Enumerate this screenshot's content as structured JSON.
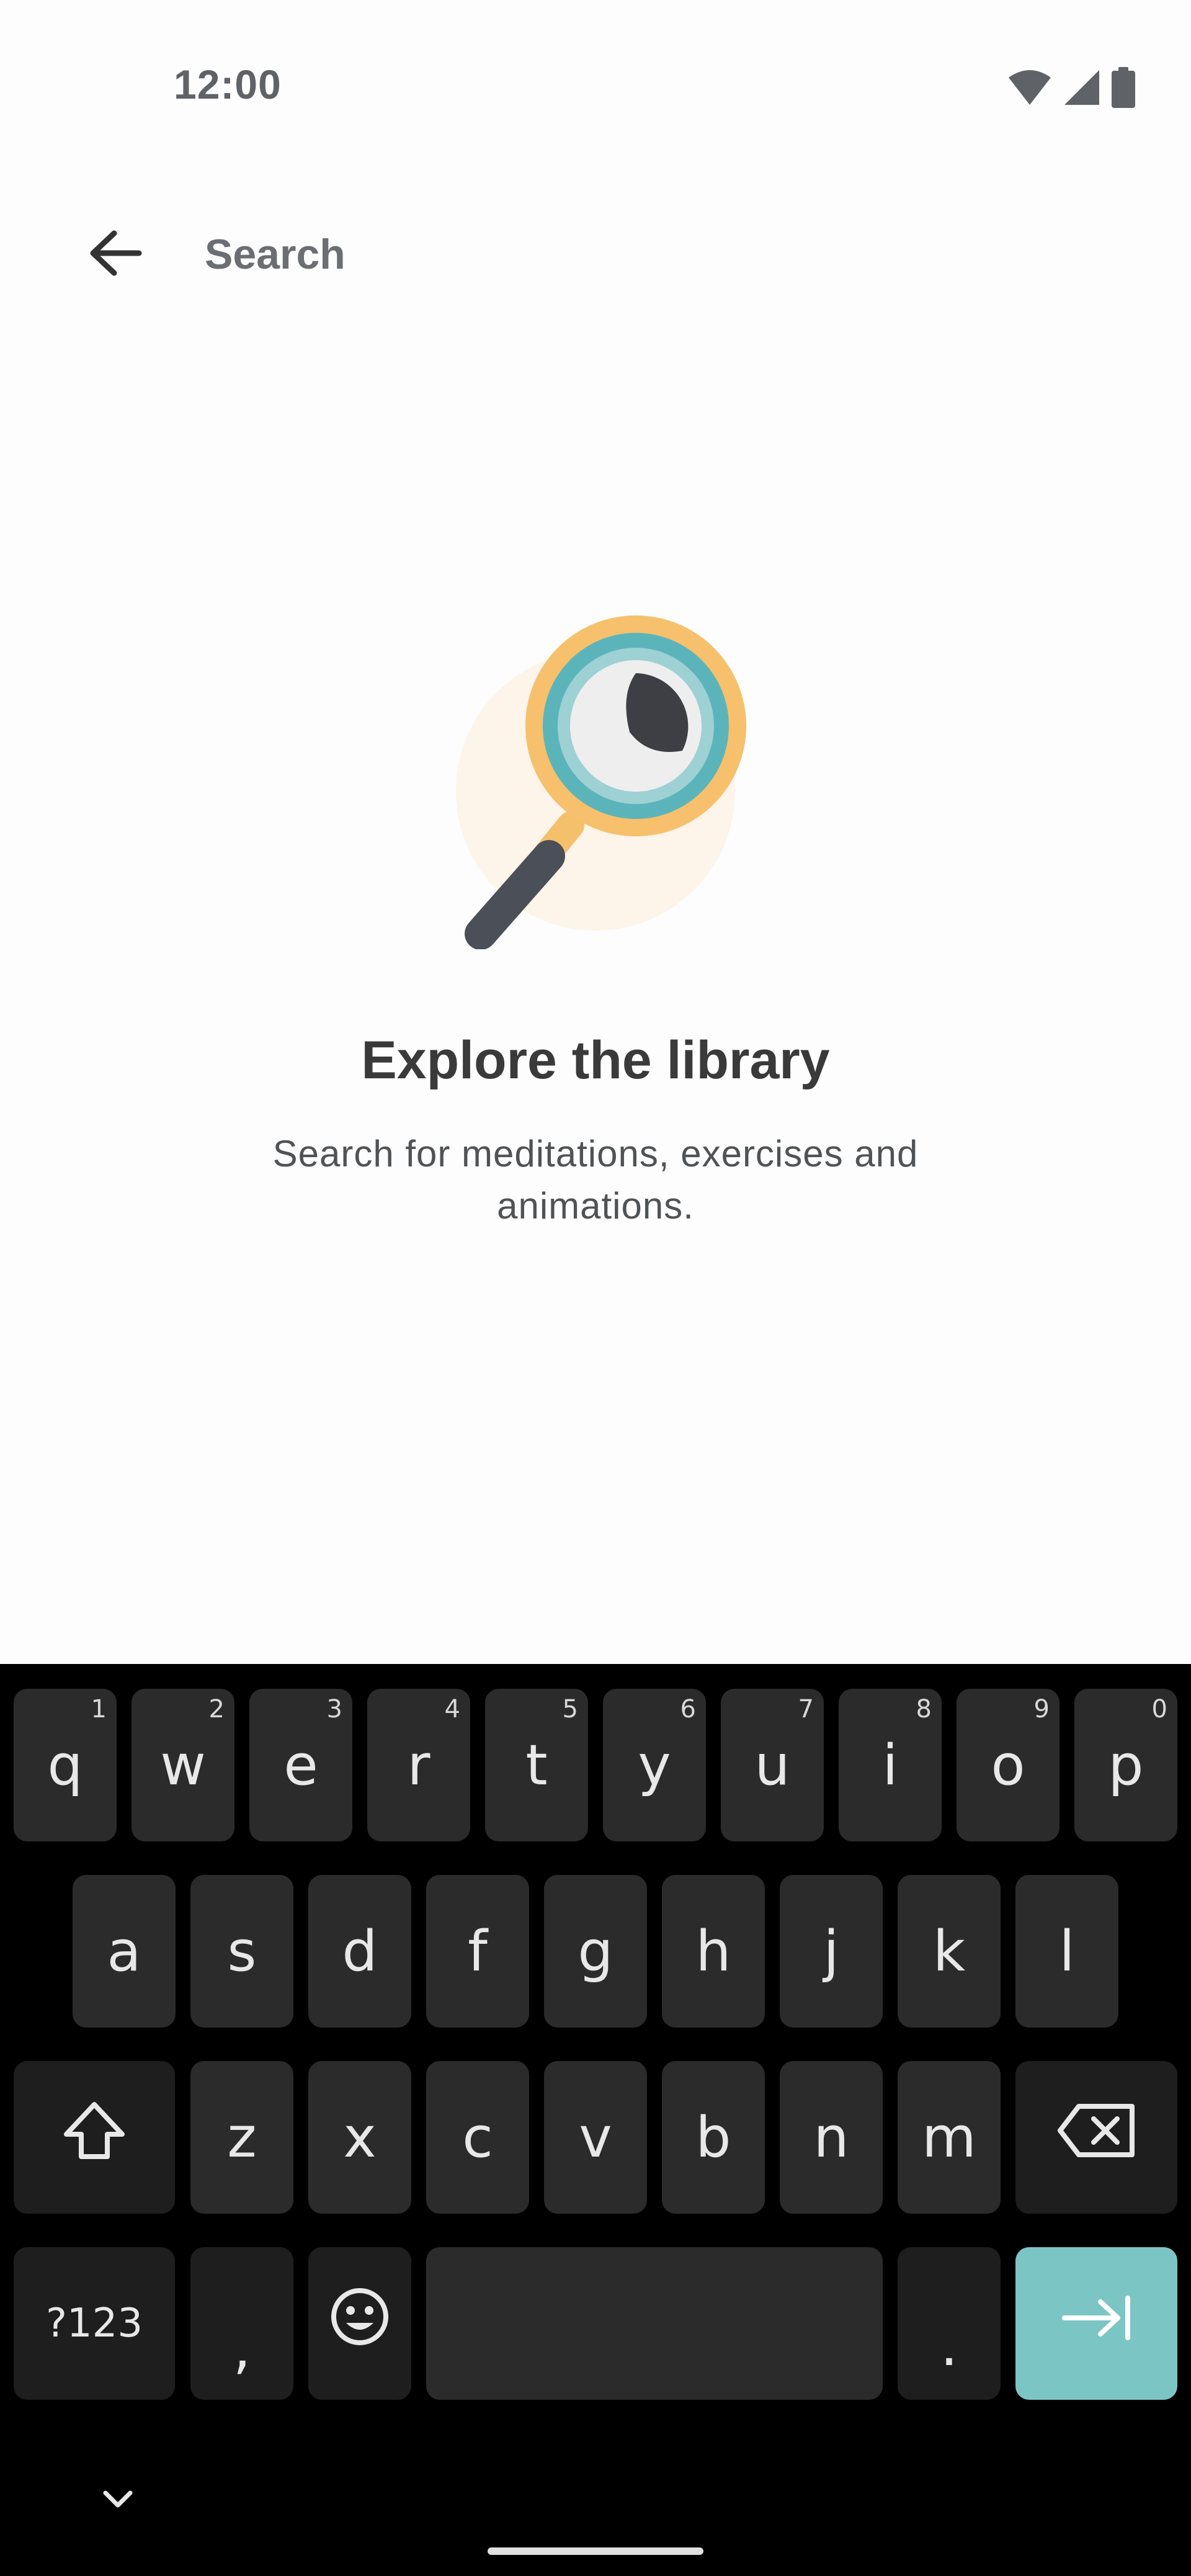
{
  "status_bar": {
    "time": "12:00",
    "icons": [
      "wifi-icon",
      "signal-icon",
      "battery-icon"
    ]
  },
  "app_bar": {
    "back_icon": "arrow-left-icon",
    "search_placeholder": "Search",
    "search_value": ""
  },
  "empty_state": {
    "illustration": "magnifying-glass-icon",
    "title": "Explore the library",
    "subtitle": "Search for meditations, exercises and animations."
  },
  "keyboard": {
    "row1": [
      {
        "label": "q",
        "hint": "1"
      },
      {
        "label": "w",
        "hint": "2"
      },
      {
        "label": "e",
        "hint": "3"
      },
      {
        "label": "r",
        "hint": "4"
      },
      {
        "label": "t",
        "hint": "5"
      },
      {
        "label": "y",
        "hint": "6"
      },
      {
        "label": "u",
        "hint": "7"
      },
      {
        "label": "i",
        "hint": "8"
      },
      {
        "label": "o",
        "hint": "9"
      },
      {
        "label": "p",
        "hint": "0"
      }
    ],
    "row2": [
      "a",
      "s",
      "d",
      "f",
      "g",
      "h",
      "j",
      "k",
      "l"
    ],
    "row3": [
      "z",
      "x",
      "c",
      "v",
      "b",
      "n",
      "m"
    ],
    "symbols_label": "?123",
    "comma_label": ",",
    "period_label": ".",
    "shift_icon": "shift-icon",
    "backspace_icon": "backspace-icon",
    "emoji_icon": "emoji-icon",
    "action_icon": "tab-right-icon",
    "hide_icon": "chevron-down-icon"
  },
  "colors": {
    "accent": "#7cc5c5",
    "background": "#fdfdfd",
    "keyboard_background": "#000000",
    "key_background": "#2b2b2b"
  }
}
